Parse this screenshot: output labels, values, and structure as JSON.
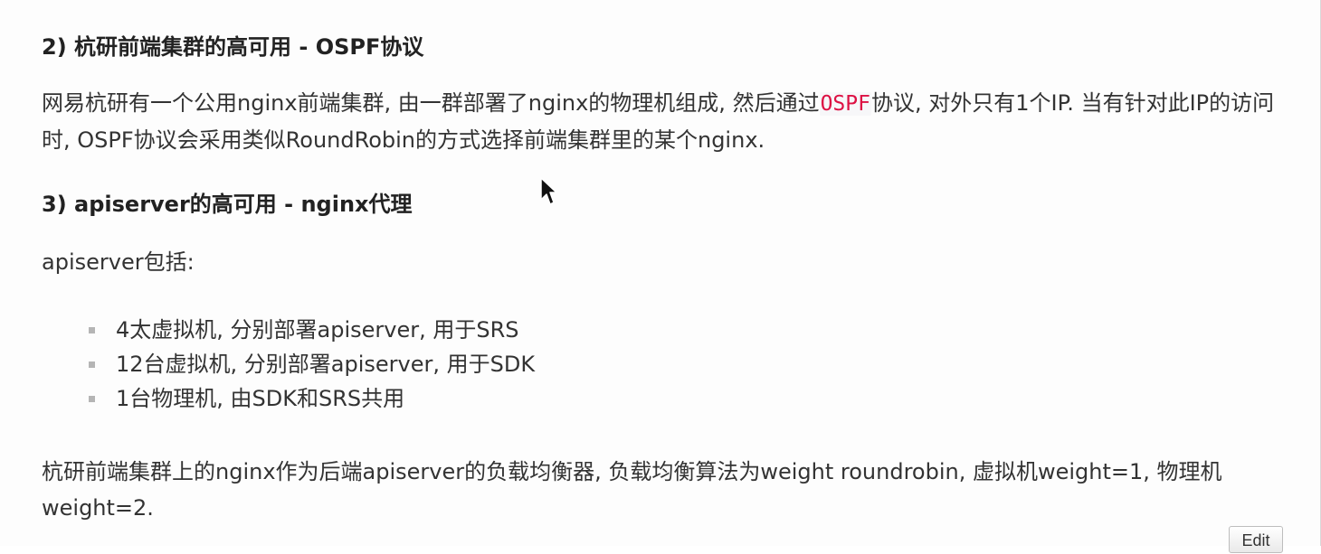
{
  "section_ospf": {
    "heading": "2) 杭研前端集群的高可用 - OSPF协议",
    "text_before": "网易杭研有一个公用nginx前端集群, 由一群部署了nginx的物理机组成, 然后通过",
    "code": "OSPF",
    "text_after": "协议, 对外只有1个IP. 当有针对此IP的访问时, OSPF协议会采用类似RoundRobin的方式选择前端集群里的某个nginx."
  },
  "section_api": {
    "heading": "3) apiserver的高可用 - nginx代理",
    "intro": "apiserver包括:",
    "items": [
      "4太虚拟机, 分别部署apiserver, 用于SRS",
      "12台虚拟机, 分别部署apiserver, 用于SDK",
      "1台物理机, 由SDK和SRS共用"
    ],
    "lb_text": "杭研前端集群上的nginx作为后端apiserver的负载均衡器, 负载均衡算法为weight roundrobin, 虚拟机weight=1, 物理机weight=2."
  },
  "edit_button": "Edit",
  "colors": {
    "code_text": "#dd1144",
    "code_bg": "#f7f7f9",
    "bullet": "#b5b5b5",
    "text": "#333333"
  },
  "icons": {
    "cursor": "mouse-pointer-icon"
  }
}
